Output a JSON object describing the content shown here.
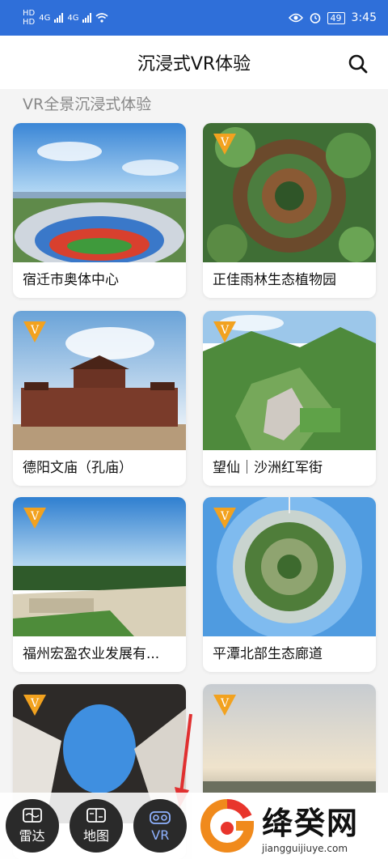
{
  "status_bar": {
    "time": "3:45",
    "battery": "49",
    "network_1": "4G",
    "network_2": "4G",
    "hd_1": "HD",
    "hd_2": "HD"
  },
  "header": {
    "title": "沉浸式VR体验"
  },
  "section": {
    "title": "VR全景沉浸式体验"
  },
  "cards": [
    {
      "label": "宿迁市奥体中心"
    },
    {
      "label": "正佳雨林生态植物园"
    },
    {
      "label": "德阳文庙（孔庙）"
    },
    {
      "label": "望仙｜沙洲红军街"
    },
    {
      "label": "福州宏盈农业发展有..."
    },
    {
      "label": "平潭北部生态廊道"
    },
    {
      "label": ""
    },
    {
      "label": ""
    }
  ],
  "badge_letter": "V",
  "bottom_nav": [
    {
      "label": "雷达",
      "icon": "map-icon"
    },
    {
      "label": "地图",
      "icon": "map-book-icon"
    },
    {
      "label": "VR",
      "icon": "vr-goggles-icon"
    }
  ],
  "watermark": {
    "title": "绛癸网",
    "url": "jiangguijiuye.com"
  },
  "colors": {
    "status_bar": "#2f6fd9",
    "badge": "#f2a21f",
    "arrow": "#e03030",
    "accent_nav": "#8fb2ff"
  }
}
